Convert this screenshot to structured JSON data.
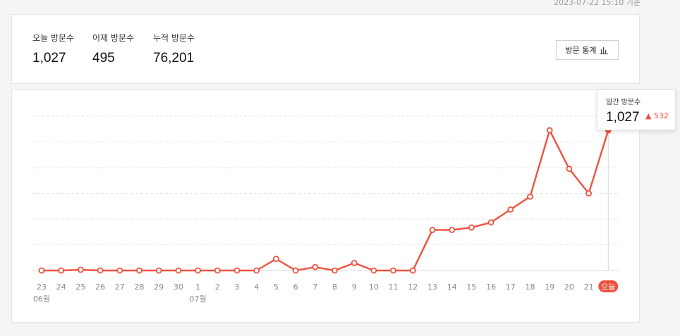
{
  "header": {
    "timestamp": "2023-07-22 15:10 기준"
  },
  "summary": {
    "today_label": "오늘 방문수",
    "today_value": "1,027",
    "yesterday_label": "어제 방문수",
    "yesterday_value": "495",
    "total_label": "누적 방문수",
    "total_value": "76,201",
    "stats_button_label": "방문 통계"
  },
  "tooltip": {
    "label": "일간 방문수",
    "value": "1,027",
    "delta": "▲ 532"
  },
  "colors": {
    "accent": "#f0513f",
    "grid": "#e6e6e6",
    "axis": "#d8d8d8",
    "tick": "#888888"
  },
  "chart_data": {
    "type": "line",
    "categories": [
      "23",
      "24",
      "25",
      "26",
      "27",
      "28",
      "29",
      "30",
      "1",
      "2",
      "3",
      "4",
      "5",
      "6",
      "7",
      "8",
      "9",
      "10",
      "11",
      "12",
      "13",
      "14",
      "15",
      "16",
      "17",
      "18",
      "19",
      "20",
      "21",
      "오늘"
    ],
    "month_labels": [
      {
        "index": 0,
        "label": "06월"
      },
      {
        "index": 8,
        "label": "07월"
      }
    ],
    "series": [
      {
        "values": [
          0,
          0,
          5,
          0,
          0,
          0,
          0,
          0,
          0,
          0,
          0,
          0,
          85,
          0,
          25,
          0,
          55,
          0,
          0,
          0,
          297,
          297,
          315,
          352,
          447,
          541,
          1027,
          745,
          565,
          1027
        ]
      }
    ],
    "ylim": [
      0,
      1130
    ],
    "grid": true,
    "highlight_index": 29
  }
}
